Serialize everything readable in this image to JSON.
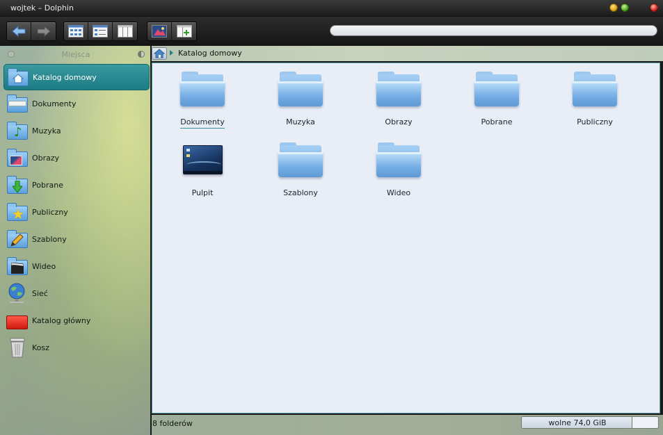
{
  "window": {
    "title": "wojtek – Dolphin"
  },
  "toolbar": {
    "buttons": [
      {
        "icon": "back-arrow-icon"
      },
      {
        "icon": "forward-arrow-icon"
      },
      {
        "icon": "icons-view-icon"
      },
      {
        "icon": "details-view-icon"
      },
      {
        "icon": "columns-view-icon"
      },
      {
        "icon": "preview-icon"
      },
      {
        "icon": "split-view-icon"
      }
    ],
    "search": {
      "value": "",
      "placeholder": ""
    }
  },
  "sidebar": {
    "title": "Miejsca",
    "items": [
      {
        "label": "Katalog domowy",
        "icon": "home-folder-icon",
        "active": true
      },
      {
        "label": "Dokumenty",
        "icon": "documents-folder-icon",
        "active": false
      },
      {
        "label": "Muzyka",
        "icon": "music-folder-icon",
        "active": false
      },
      {
        "label": "Obrazy",
        "icon": "pictures-folder-icon",
        "active": false
      },
      {
        "label": "Pobrane",
        "icon": "downloads-folder-icon",
        "active": false
      },
      {
        "label": "Publiczny",
        "icon": "public-folder-icon",
        "active": false
      },
      {
        "label": "Szablony",
        "icon": "templates-folder-icon",
        "active": false
      },
      {
        "label": "Wideo",
        "icon": "videos-folder-icon",
        "active": false
      },
      {
        "label": "Sieć",
        "icon": "network-globe-icon",
        "active": false
      },
      {
        "label": "Katalog główny",
        "icon": "root-folder-icon",
        "active": false
      },
      {
        "label": "Kosz",
        "icon": "trash-icon",
        "active": false
      }
    ]
  },
  "breadcrumb": {
    "items": [
      "Katalog domowy"
    ]
  },
  "main": {
    "items": [
      {
        "label": "Dokumenty",
        "icon": "folder-icon",
        "focused": true
      },
      {
        "label": "Muzyka",
        "icon": "folder-icon",
        "focused": false
      },
      {
        "label": "Obrazy",
        "icon": "folder-icon",
        "focused": false
      },
      {
        "label": "Pobrane",
        "icon": "folder-icon",
        "focused": false
      },
      {
        "label": "Publiczny",
        "icon": "folder-icon",
        "focused": false
      },
      {
        "label": "Pulpit",
        "icon": "desktop-thumbnail-icon",
        "focused": false
      },
      {
        "label": "Szablony",
        "icon": "folder-icon",
        "focused": false
      },
      {
        "label": "Wideo",
        "icon": "folder-icon",
        "focused": false
      }
    ]
  },
  "status": {
    "text": "8 folderów",
    "free_space": "wolne 74,0 GiB",
    "used_fraction": 0.81
  },
  "colors": {
    "accent": "#1d7b83",
    "folder": "#75ade4",
    "view_background": "#e8edf6"
  }
}
